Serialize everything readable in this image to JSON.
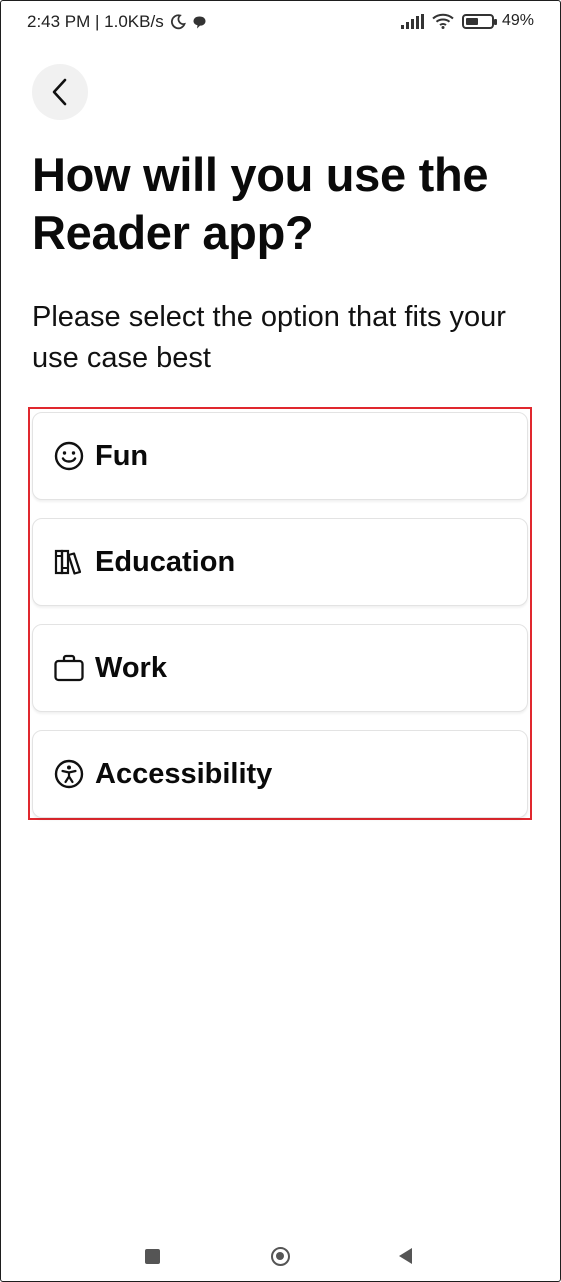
{
  "status_bar": {
    "time_speed": "2:43 PM | 1.0KB/s",
    "moon_icon": "moon-icon",
    "chat_icon": "chat-bubble-icon",
    "signal_icon": "signal-icon",
    "wifi_icon": "wifi-icon",
    "battery_level": 0.49,
    "battery_text": "49%"
  },
  "header": {
    "back_icon": "chevron-left-icon",
    "title": "How will you use the Reader app?",
    "subtitle": "Please select the option that fits your use case best"
  },
  "options": [
    {
      "label": "Fun",
      "icon": "smiley-icon"
    },
    {
      "label": "Education",
      "icon": "books-icon"
    },
    {
      "label": "Work",
      "icon": "briefcase-icon"
    },
    {
      "label": "Accessibility",
      "icon": "accessibility-icon"
    }
  ],
  "highlight_color": "#e0282e",
  "nav_bar": {
    "recents_icon": "square-icon",
    "home_icon": "circle-icon",
    "back_icon": "triangle-back-icon"
  }
}
